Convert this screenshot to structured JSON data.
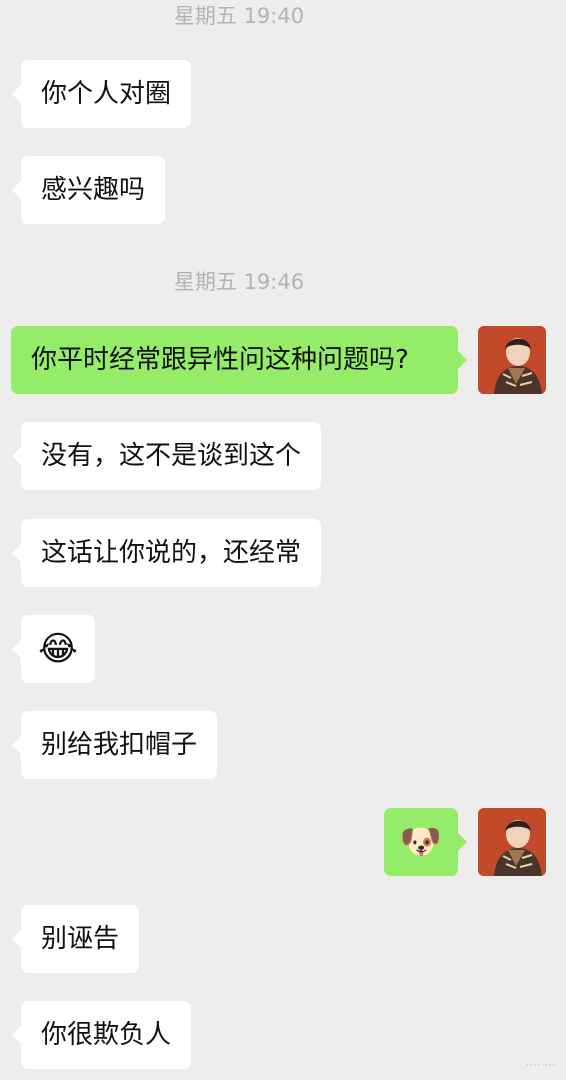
{
  "chat": {
    "timestamps": [
      "星期五 19:40",
      "星期五 19:46"
    ],
    "messages": [
      {
        "side": "left",
        "text": "你个人对圈"
      },
      {
        "side": "left",
        "text": "感兴趣吗"
      },
      {
        "side": "right",
        "text": "你平时经常跟异性问这种问题吗?"
      },
      {
        "side": "left",
        "text": "没有，这不是谈到这个"
      },
      {
        "side": "left",
        "text": "这话让你说的，还经常"
      },
      {
        "side": "left",
        "text": "😂"
      },
      {
        "side": "left",
        "text": "别给我扣帽子"
      },
      {
        "side": "right",
        "text": "🐶"
      },
      {
        "side": "left",
        "text": "别诬告"
      },
      {
        "side": "left",
        "text": "你很欺负人"
      }
    ]
  },
  "avatar": {
    "icon": "user-avatar-icon"
  },
  "watermark": "········"
}
